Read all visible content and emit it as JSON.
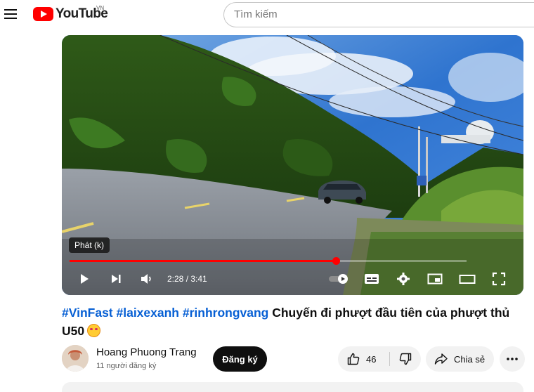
{
  "masthead": {
    "logo_text": "YouTube",
    "country_code": "VN",
    "search_placeholder": "Tìm kiếm"
  },
  "player": {
    "tooltip": "Phát (k)",
    "time_current": "2:28",
    "time_separator": " / ",
    "time_total": "3:41",
    "progress_fraction": 0.67,
    "accent_color": "#ff0000",
    "icons": [
      "play-icon",
      "next-icon",
      "volume-icon",
      "autoplay-toggle-icon",
      "subtitles-icon",
      "settings-icon",
      "miniplayer-icon",
      "theater-icon",
      "fullscreen-icon"
    ]
  },
  "video": {
    "title_tags": "#VinFast #laixexanh #rinhrongvang",
    "title_text": " Chuyến đi phượt đầu tiên của phượt thủ U50"
  },
  "owner": {
    "channel_name": "Hoang Phuong Trang",
    "subscriber_count": "11 người đăng ký",
    "subscribe_label": "Đăng ký"
  },
  "actions": {
    "like_count": "46",
    "share_label": "Chia sẻ"
  }
}
